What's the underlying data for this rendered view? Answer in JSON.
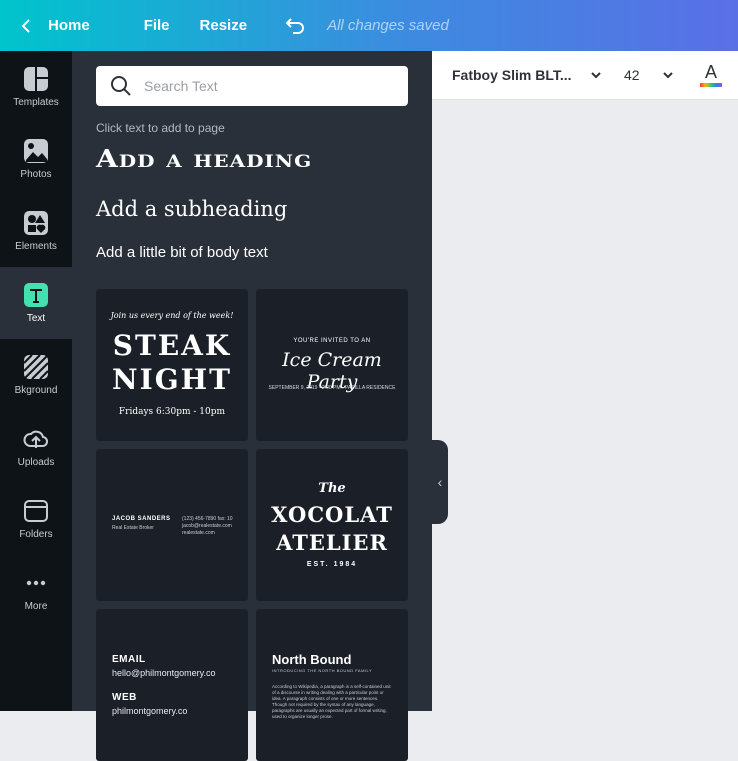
{
  "topbar": {
    "home_label": "Home",
    "file_label": "File",
    "resize_label": "Resize",
    "status": "All changes saved",
    "icons": [
      "chevron-left-icon",
      "undo-icon"
    ]
  },
  "rail": {
    "items": [
      {
        "label": "Templates",
        "icon": "templates-icon"
      },
      {
        "label": "Photos",
        "icon": "photos-icon"
      },
      {
        "label": "Elements",
        "icon": "elements-icon"
      },
      {
        "label": "Text",
        "icon": "text-icon",
        "active": true
      },
      {
        "label": "Bkground",
        "icon": "background-icon"
      },
      {
        "label": "Uploads",
        "icon": "uploads-icon"
      },
      {
        "label": "Folders",
        "icon": "folder-icon"
      },
      {
        "label": "More",
        "icon": "more-icon"
      }
    ]
  },
  "panel": {
    "search_placeholder": "Search Text",
    "hint": "Click text to add to page",
    "heading": "Add a heading",
    "subheading": "Add a subheading",
    "body": "Add a little bit of body text",
    "templates": {
      "steak": {
        "top": "Join us every end of the week!",
        "main1": "STEAK",
        "main2": "NIGHT",
        "bottom": "Fridays 6:30pm - 10pm"
      },
      "icecream": {
        "top": "YOU'RE INVITED TO AN",
        "main": "Ice Cream Party",
        "bottom": "SEPTEMBER 9, 2019 · 2:00 PM · PADILLA RESIDENCE"
      },
      "card": {
        "name": "JACOB SANDERS",
        "role": "Real Estate Broker",
        "contact1": "(123) 456-7890 fax: 10",
        "contact2": "jacob@realestate.com",
        "contact3": "realestate.com"
      },
      "xocolat": {
        "the": "The",
        "main1": "XOCOLAT",
        "main2": "ATELIER",
        "est": "EST. 1984"
      },
      "contact": {
        "email_label": "EMAIL",
        "email_value": "hello@philmontgomery.co",
        "web_label": "WEB",
        "web_value": "philmontgomery.co"
      },
      "northbound": {
        "title": "North Bound",
        "subtitle": "INTRODUCING THE NORTH BOUND FAMILY",
        "body": "According to Wikipedia, a paragraph is a self-contained unit of a discourse in writing dealing with a particular point or idea. A paragraph consists of one or more sentences. Though not required by the syntax of any language, paragraphs are usually an expected part of formal writing, used to organize longer prose."
      }
    }
  },
  "toolbar": {
    "font_name": "Fatboy Slim BLT...",
    "font_size": "42",
    "text_color_glyph": "A",
    "icons": [
      "chevron-down-icon",
      "text-color-icon"
    ]
  },
  "collapse_glyph": "‹",
  "colors": {
    "rail_bg": "#0e1318",
    "panel_bg": "#293039",
    "tile_bg": "#1b2028",
    "canvas_bg": "#ebecf0",
    "accent_text_icon": "#43e0b0"
  }
}
